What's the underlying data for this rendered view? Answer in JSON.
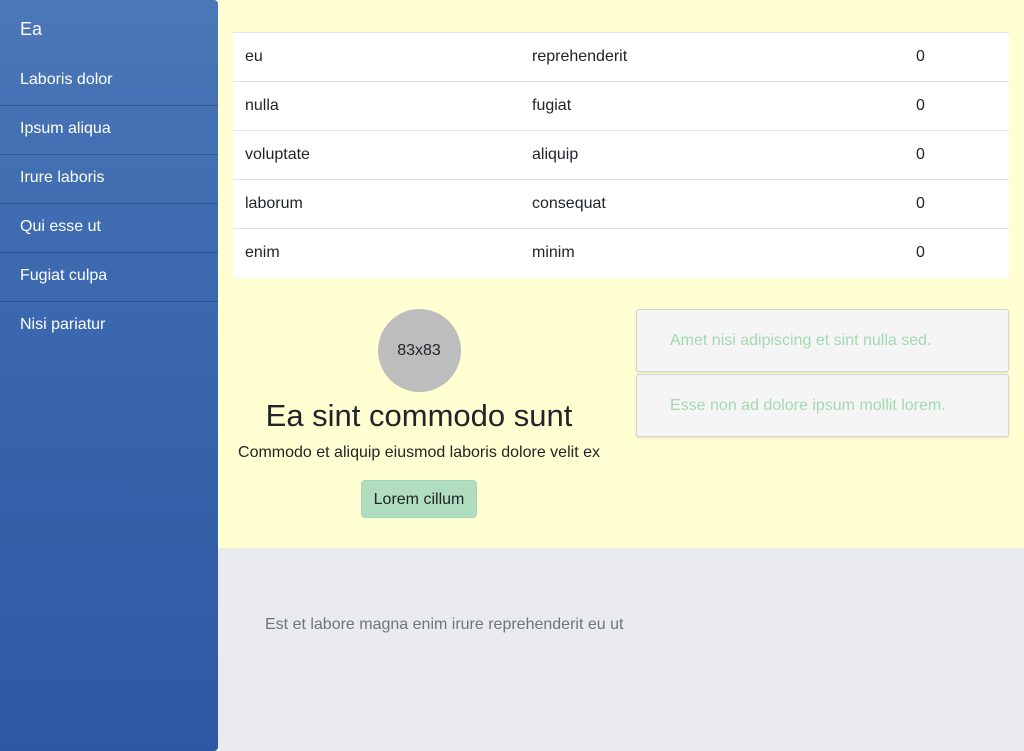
{
  "sidebar": {
    "brand": "Ea",
    "items": [
      {
        "label": "Laboris dolor"
      },
      {
        "label": "Ipsum aliqua"
      },
      {
        "label": "Irure laboris"
      },
      {
        "label": "Qui esse ut"
      },
      {
        "label": "Fugiat culpa"
      },
      {
        "label": "Nisi pariatur"
      }
    ]
  },
  "table": {
    "rows": [
      [
        "eu",
        "reprehenderit",
        "0"
      ],
      [
        "nulla",
        "fugiat",
        "0"
      ],
      [
        "voluptate",
        "aliquip",
        "0"
      ],
      [
        "laborum",
        "consequat",
        "0"
      ],
      [
        "enim",
        "minim",
        "0"
      ]
    ]
  },
  "hero": {
    "avatar_text": "83x83",
    "title": "Ea sint commodo sunt",
    "text": "Commodo et aliquip eiusmod laboris dolore velit ex",
    "button_label": "Lorem cillum"
  },
  "list": {
    "items": [
      {
        "text": "Amet nisi adipiscing et sint nulla sed."
      },
      {
        "text": "Esse non ad dolore ipsum mollit lorem."
      }
    ]
  },
  "footer": {
    "text": "Est et labore magna enim irure reprehenderit eu ut"
  },
  "colors": {
    "page_background": "#ffffd1",
    "sidebar_top": "#4c77b8",
    "sidebar_bottom": "#2f58a3",
    "button_background": "#b0dcc0",
    "list_text": "#a3d9b1",
    "footer_background": "#e9ebee"
  }
}
